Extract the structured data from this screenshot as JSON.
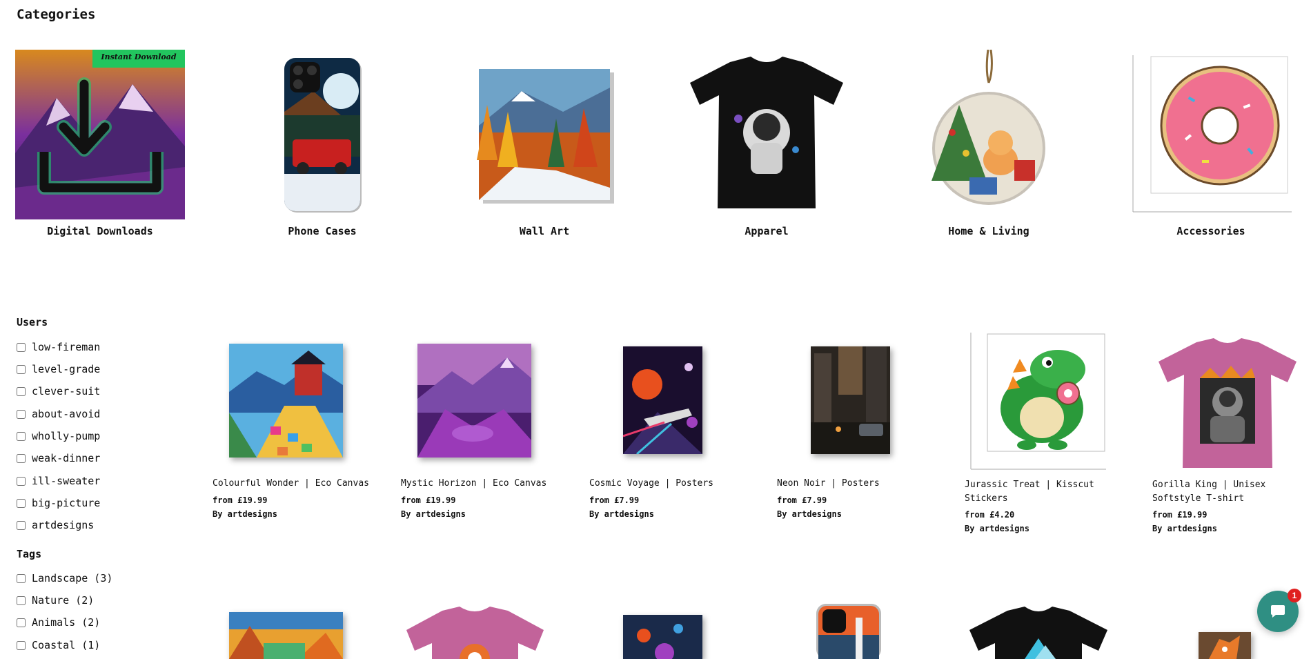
{
  "categories_section": {
    "title": "Categories",
    "items": [
      {
        "label": "Digital Downloads",
        "badge": "Instant Download",
        "icon": "download-icon"
      },
      {
        "label": "Phone Cases"
      },
      {
        "label": "Wall Art"
      },
      {
        "label": "Apparel"
      },
      {
        "label": "Home & Living"
      },
      {
        "label": "Accessories"
      }
    ]
  },
  "sidebar": {
    "users_heading": "Users",
    "users": [
      "low-fireman",
      "level-grade",
      "clever-suit",
      "about-avoid",
      "wholly-pump",
      "weak-dinner",
      "ill-sweater",
      "big-picture",
      "artdesigns"
    ],
    "tags_heading": "Tags",
    "tags": [
      "Landscape (3)",
      "Nature (2)",
      "Animals (2)",
      "Coastal (1)"
    ]
  },
  "products": [
    {
      "title": "Colourful Wonder | Eco Canvas",
      "price": "from £19.99",
      "by": "By artdesigns"
    },
    {
      "title": "Mystic Horizon | Eco Canvas",
      "price": "from £19.99",
      "by": "By artdesigns"
    },
    {
      "title": "Cosmic Voyage | Posters",
      "price": "from £7.99",
      "by": "By artdesigns"
    },
    {
      "title": "Neon Noir | Posters",
      "price": "from £7.99",
      "by": "By artdesigns"
    },
    {
      "title": "Jurassic Treat | Kisscut Stickers",
      "price": "from £4.20",
      "by": "By artdesigns"
    },
    {
      "title": "Gorilla King | Unisex Softstyle T-shirt",
      "price": "from £19.99",
      "by": "By artdesigns"
    }
  ],
  "chat": {
    "badge_count": "1",
    "icon": "chat-bubble-icon"
  },
  "colors": {
    "badge_green": "#22c55e",
    "chat_teal": "#2f8f83",
    "badge_red": "#e02020"
  }
}
